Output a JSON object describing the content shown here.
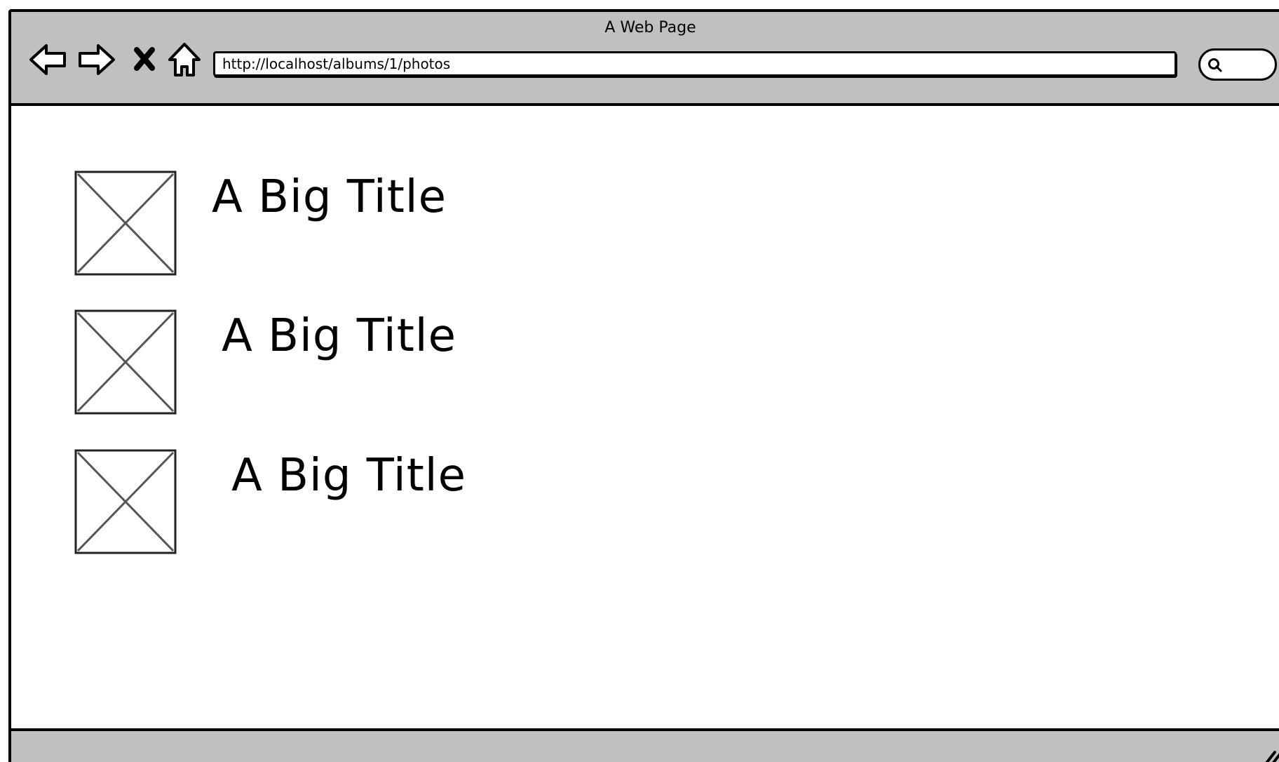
{
  "window": {
    "title": "A Web Page"
  },
  "toolbar": {
    "buttons": [
      {
        "name": "back-button",
        "icon": "arrow-left-icon"
      },
      {
        "name": "forward-button",
        "icon": "arrow-right-icon"
      },
      {
        "name": "stop-button",
        "icon": "close-icon"
      },
      {
        "name": "home-button",
        "icon": "home-icon"
      }
    ],
    "url": "http://localhost/albums/1/photos",
    "search_icon": "search-icon"
  },
  "content": {
    "items": [
      {
        "title": "A Big Title",
        "image": "image-placeholder-icon"
      },
      {
        "title": "A Big Title",
        "image": "image-placeholder-icon"
      },
      {
        "title": "A Big Title",
        "image": "image-placeholder-icon"
      }
    ]
  },
  "colors": {
    "chrome": "#c0c0c0",
    "border": "#000000",
    "placeholder_stroke": "#555555"
  }
}
